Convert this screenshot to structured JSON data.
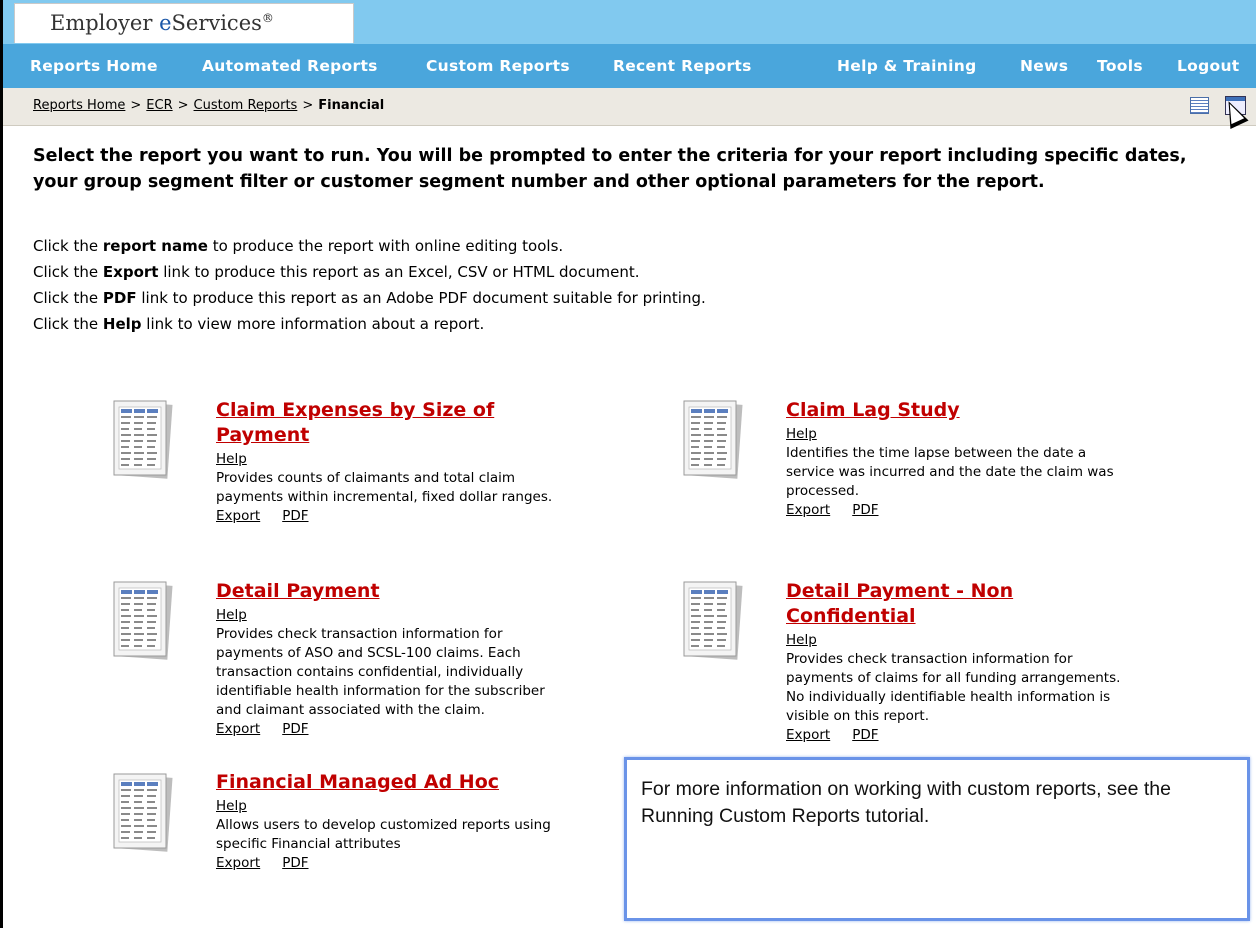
{
  "brand": {
    "name_prefix": "Employer ",
    "name_e": "e",
    "name_suffix": "Services",
    "reg": "®"
  },
  "nav": {
    "items": [
      "Reports Home",
      "Automated Reports",
      "Custom Reports",
      "Recent Reports",
      "Help & Training",
      "News",
      "Tools",
      "Logout"
    ]
  },
  "breadcrumb": {
    "items": [
      "Reports Home",
      "ECR",
      "Custom Reports"
    ],
    "separator": ">",
    "current": "Financial"
  },
  "intro": "Select the report you want to run.  You will be prompted to enter the criteria for your report including specific dates, your group segment filter or customer segment number and other optional parameters for the report.",
  "instructions": [
    {
      "pre": "Click the ",
      "bold": "report name",
      "post": " to produce the report with online editing tools."
    },
    {
      "pre": "Click the ",
      "bold": "Export",
      "post": " link to produce this report as an Excel, CSV or HTML document."
    },
    {
      "pre": "Click the ",
      "bold": "PDF",
      "post": " link to produce this report as an Adobe PDF document suitable for printing."
    },
    {
      "pre": "Click the ",
      "bold": "Help",
      "post": " link to view more information about a report."
    }
  ],
  "reports": [
    {
      "title": "Claim Expenses by Size of Payment",
      "help": "Help",
      "description": "Provides counts of claimants and total claim payments within incremental, fixed dollar ranges.",
      "export": "Export",
      "pdf": "PDF"
    },
    {
      "title": "Claim Lag Study",
      "help": "Help",
      "description": "Identifies the time lapse between the date a service was incurred and the date the claim was processed.",
      "export": "Export",
      "pdf": "PDF"
    },
    {
      "title": "Detail Payment",
      "help": "Help",
      "description": "Provides check transaction information for payments of ASO and SCSL-100 claims.  Each transaction contains confidential, individually identifiable health information for the subscriber and claimant associated with the claim.",
      "export": "Export",
      "pdf": "PDF"
    },
    {
      "title": "Detail Payment - Non Confidential",
      "help": "Help",
      "description": "Provides check transaction information for payments of claims for all funding arrangements.  No individually identifiable health information is visible on this report.",
      "export": "Export",
      "pdf": "PDF"
    },
    {
      "title": "Financial Managed Ad Hoc",
      "help": "Help",
      "description": "Allows users to develop customized reports using specific Financial attributes",
      "export": "Export",
      "pdf": "PDF"
    }
  ],
  "callout": "For more information on working with custom reports, see the Running Custom Reports tutorial.",
  "icons": [
    "report-document-icon",
    "table-view-icon",
    "print-view-icon",
    "mouse-pointer-icon"
  ],
  "colors": {
    "brand_bar": "#81c9ef",
    "nav_bar": "#4aa6dc",
    "report_title": "#c00000",
    "callout_border": "#6a93e8"
  }
}
